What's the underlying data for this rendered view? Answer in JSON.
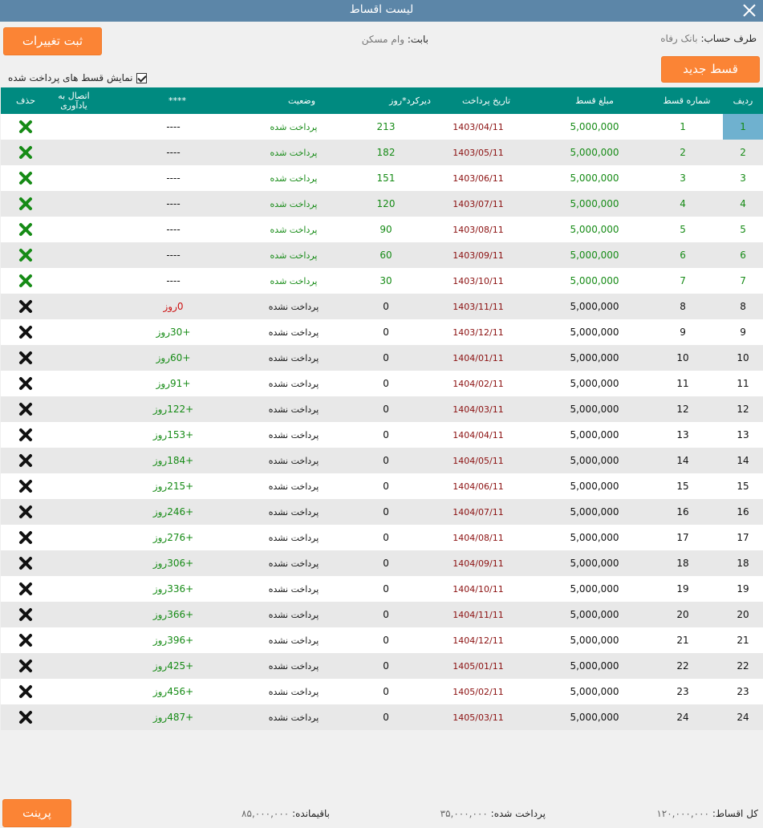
{
  "window": {
    "title": "لیست اقساط"
  },
  "header": {
    "save_label": "ثبت تغییرات",
    "new_label": "قسط جدید",
    "party_label": "طرف حساب:",
    "party_value": "بانک رفاه",
    "subject_label": "بابت:",
    "subject_value": "وام مسکن",
    "show_paid_label": "نمایش قسط های پرداخت شده",
    "show_paid_checked": true
  },
  "columns": {
    "idx": "ردیف",
    "number": "شماره قسط",
    "amount": "مبلغ قسط",
    "date": "تاریخ پرداخت",
    "delay": "دیرکرد*روز",
    "status": "وضعیت",
    "stars": "****",
    "reminder": "اتصال به یادآوری",
    "delete": "حذف"
  },
  "rows": [
    {
      "idx": "1",
      "num": "1",
      "amount": "5,000,000",
      "date": "1403/04/11",
      "delay": "213",
      "status": "پرداخت شده",
      "rem": "----",
      "paid": true
    },
    {
      "idx": "2",
      "num": "2",
      "amount": "5,000,000",
      "date": "1403/05/11",
      "delay": "182",
      "status": "پرداخت شده",
      "rem": "----",
      "paid": true
    },
    {
      "idx": "3",
      "num": "3",
      "amount": "5,000,000",
      "date": "1403/06/11",
      "delay": "151",
      "status": "پرداخت شده",
      "rem": "----",
      "paid": true
    },
    {
      "idx": "4",
      "num": "4",
      "amount": "5,000,000",
      "date": "1403/07/11",
      "delay": "120",
      "status": "پرداخت شده",
      "rem": "----",
      "paid": true
    },
    {
      "idx": "5",
      "num": "5",
      "amount": "5,000,000",
      "date": "1403/08/11",
      "delay": "90",
      "status": "پرداخت شده",
      "rem": "----",
      "paid": true
    },
    {
      "idx": "6",
      "num": "6",
      "amount": "5,000,000",
      "date": "1403/09/11",
      "delay": "60",
      "status": "پرداخت شده",
      "rem": "----",
      "paid": true
    },
    {
      "idx": "7",
      "num": "7",
      "amount": "5,000,000",
      "date": "1403/10/11",
      "delay": "30",
      "status": "پرداخت شده",
      "rem": "----",
      "paid": true
    },
    {
      "idx": "8",
      "num": "8",
      "amount": "5,000,000",
      "date": "1403/11/11",
      "delay": "0",
      "status": "پرداخت نشده",
      "rem": "0روز",
      "paid": false
    },
    {
      "idx": "9",
      "num": "9",
      "amount": "5,000,000",
      "date": "1403/12/11",
      "delay": "0",
      "status": "پرداخت نشده",
      "rem": "+30روز",
      "paid": false
    },
    {
      "idx": "10",
      "num": "10",
      "amount": "5,000,000",
      "date": "1404/01/11",
      "delay": "0",
      "status": "پرداخت نشده",
      "rem": "+60روز",
      "paid": false
    },
    {
      "idx": "11",
      "num": "11",
      "amount": "5,000,000",
      "date": "1404/02/11",
      "delay": "0",
      "status": "پرداخت نشده",
      "rem": "+91روز",
      "paid": false
    },
    {
      "idx": "12",
      "num": "12",
      "amount": "5,000,000",
      "date": "1404/03/11",
      "delay": "0",
      "status": "پرداخت نشده",
      "rem": "+122روز",
      "paid": false
    },
    {
      "idx": "13",
      "num": "13",
      "amount": "5,000,000",
      "date": "1404/04/11",
      "delay": "0",
      "status": "پرداخت نشده",
      "rem": "+153روز",
      "paid": false
    },
    {
      "idx": "14",
      "num": "14",
      "amount": "5,000,000",
      "date": "1404/05/11",
      "delay": "0",
      "status": "پرداخت نشده",
      "rem": "+184روز",
      "paid": false
    },
    {
      "idx": "15",
      "num": "15",
      "amount": "5,000,000",
      "date": "1404/06/11",
      "delay": "0",
      "status": "پرداخت نشده",
      "rem": "+215روز",
      "paid": false
    },
    {
      "idx": "16",
      "num": "16",
      "amount": "5,000,000",
      "date": "1404/07/11",
      "delay": "0",
      "status": "پرداخت نشده",
      "rem": "+246روز",
      "paid": false
    },
    {
      "idx": "17",
      "num": "17",
      "amount": "5,000,000",
      "date": "1404/08/11",
      "delay": "0",
      "status": "پرداخت نشده",
      "rem": "+276روز",
      "paid": false
    },
    {
      "idx": "18",
      "num": "18",
      "amount": "5,000,000",
      "date": "1404/09/11",
      "delay": "0",
      "status": "پرداخت نشده",
      "rem": "+306روز",
      "paid": false
    },
    {
      "idx": "19",
      "num": "19",
      "amount": "5,000,000",
      "date": "1404/10/11",
      "delay": "0",
      "status": "پرداخت نشده",
      "rem": "+336روز",
      "paid": false
    },
    {
      "idx": "20",
      "num": "20",
      "amount": "5,000,000",
      "date": "1404/11/11",
      "delay": "0",
      "status": "پرداخت نشده",
      "rem": "+366روز",
      "paid": false
    },
    {
      "idx": "21",
      "num": "21",
      "amount": "5,000,000",
      "date": "1404/12/11",
      "delay": "0",
      "status": "پرداخت نشده",
      "rem": "+396روز",
      "paid": false
    },
    {
      "idx": "22",
      "num": "22",
      "amount": "5,000,000",
      "date": "1405/01/11",
      "delay": "0",
      "status": "پرداخت نشده",
      "rem": "+425روز",
      "paid": false
    },
    {
      "idx": "23",
      "num": "23",
      "amount": "5,000,000",
      "date": "1405/02/11",
      "delay": "0",
      "status": "پرداخت نشده",
      "rem": "+456روز",
      "paid": false
    },
    {
      "idx": "24",
      "num": "24",
      "amount": "5,000,000",
      "date": "1405/03/11",
      "delay": "0",
      "status": "پرداخت نشده",
      "rem": "+487روز",
      "paid": false
    }
  ],
  "footer": {
    "print_label": "پرینت",
    "total_label": "کل اقساط:",
    "total_value": "۱۲۰,۰۰۰,۰۰۰",
    "paid_label": "پرداخت شده:",
    "paid_value": "۳۵,۰۰۰,۰۰۰",
    "remaining_label": "باقیمانده:",
    "remaining_value": "۸۵,۰۰۰,۰۰۰"
  },
  "colors": {
    "titlebar": "#5c86a8",
    "header": "#008a80",
    "accent": "#fb8435",
    "paid_green": "#168b16",
    "selected": "#6fb1cf"
  }
}
